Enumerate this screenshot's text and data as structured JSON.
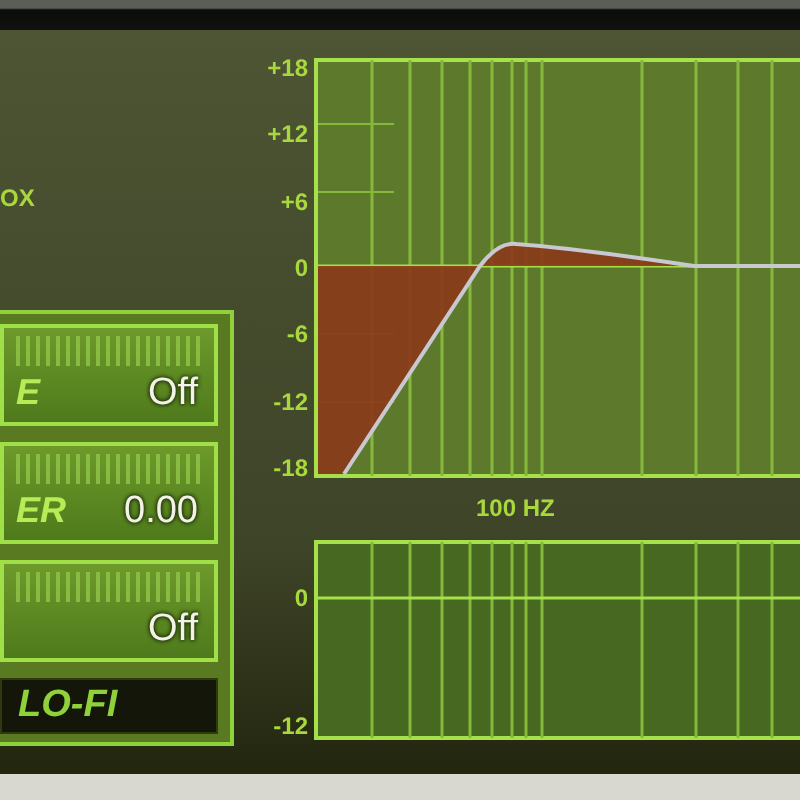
{
  "header": {
    "label": "OX"
  },
  "controls": [
    {
      "label": "E",
      "value": "Off"
    },
    {
      "label": "ER",
      "value": "0.00"
    },
    {
      "value": "Off"
    }
  ],
  "title_badge": "LO-FI",
  "eq_graph": {
    "y_labels": [
      "+18",
      "+12",
      "+6",
      "0",
      "-6",
      "-12",
      "-18"
    ],
    "freq_label": "100 HZ"
  },
  "lower_graph": {
    "y_labels": [
      "0",
      "-12"
    ]
  }
}
